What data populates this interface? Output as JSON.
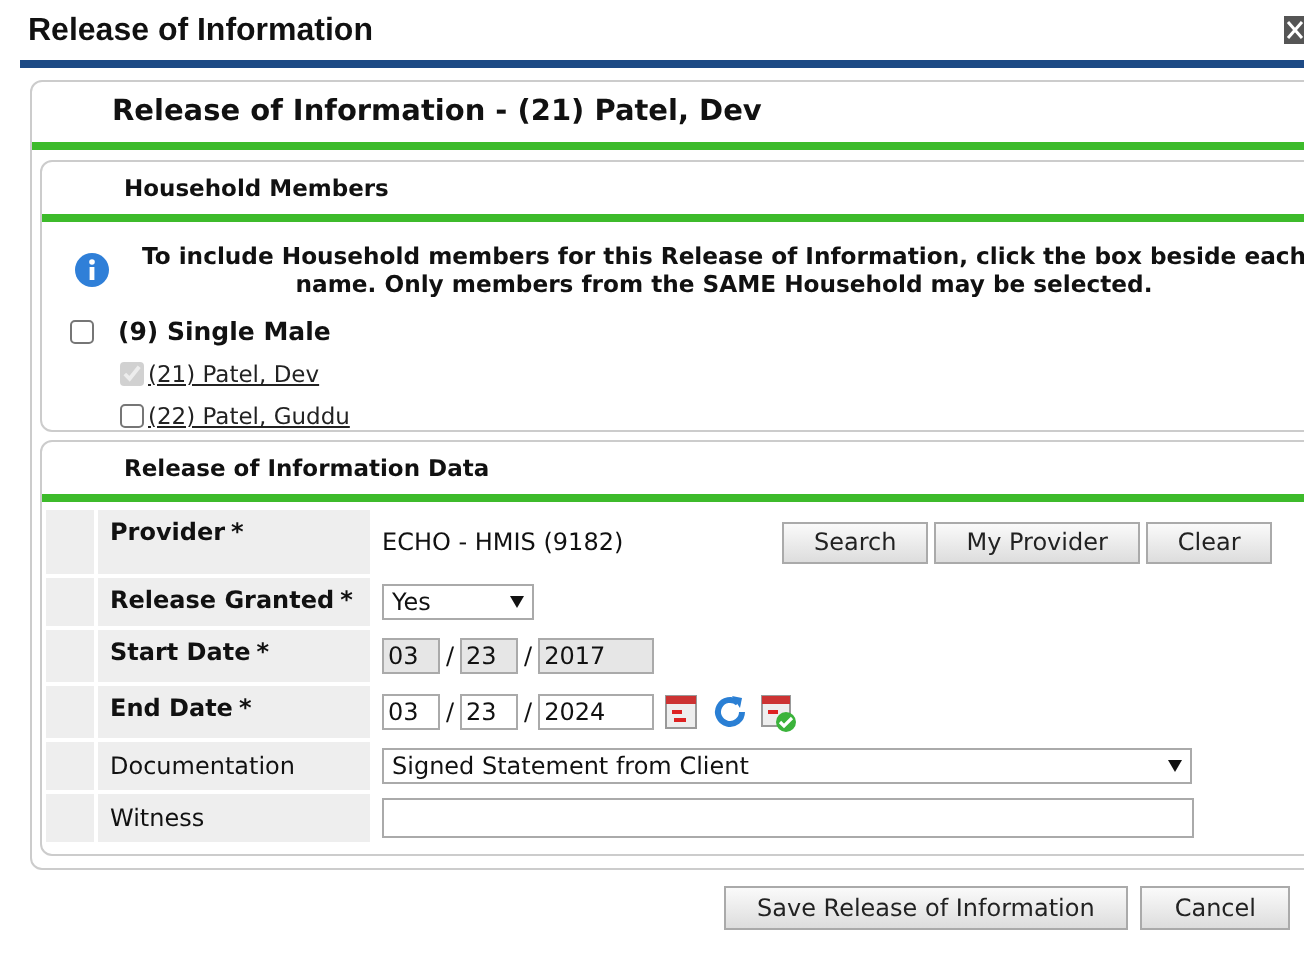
{
  "dialog": {
    "title": "Release of Information"
  },
  "header": "Release of Information - (21) Patel, Dev",
  "household": {
    "title": "Household Members",
    "info": "To include Household members for this Release of Information, click the box beside each name. Only members from the SAME Household may be selected.",
    "group": {
      "label": "(9) Single Male",
      "checked": false
    },
    "members": [
      {
        "label": "(21) Patel, Dev",
        "checked": true,
        "disabled": true
      },
      {
        "label": "(22) Patel, Guddu",
        "checked": false,
        "disabled": false
      }
    ]
  },
  "data_section": {
    "title": "Release of Information Data",
    "rows": [
      {
        "kind": "provider",
        "label": "Provider",
        "required_mark": "*",
        "value": "ECHO - HMIS (9182)",
        "buttons": [
          "Search",
          "My Provider",
          "Clear"
        ]
      },
      {
        "kind": "select",
        "label": "Release Granted",
        "required_mark": "*",
        "value": "Yes"
      },
      {
        "kind": "date",
        "label": "Start Date",
        "required_mark": "*",
        "month": "03",
        "day": "23",
        "year": "2017",
        "disabled": true,
        "separator": "/"
      },
      {
        "kind": "date",
        "label": "End Date",
        "required_mark": "*",
        "month": "03",
        "day": "23",
        "year": "2024",
        "disabled": false,
        "separator": "/"
      },
      {
        "kind": "wide_select",
        "label": "Documentation",
        "value": "Signed Statement from Client"
      },
      {
        "kind": "text",
        "label": "Witness"
      }
    ]
  },
  "buttons": [
    "Save Release of Information",
    "Cancel"
  ]
}
